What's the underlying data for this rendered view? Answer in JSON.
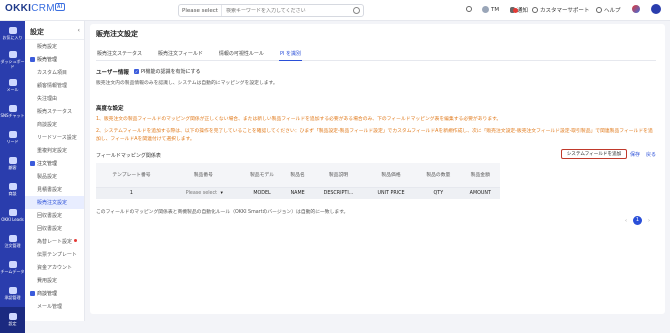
{
  "app": {
    "logo_main": "OKKI",
    "logo_crm": "CRM",
    "logo_ai": "AI"
  },
  "search": {
    "scope": "Please select",
    "placeholder": "検索キーワードを入力してください"
  },
  "topbar": {
    "user": "TM",
    "notice": "通知",
    "support": "カスタマーサポート",
    "help": "ヘルプ"
  },
  "lnav": [
    {
      "label": "お気に入り"
    },
    {
      "label": "ダッシュボード"
    },
    {
      "label": "メール"
    },
    {
      "label": "SNSチャット"
    },
    {
      "label": "リード"
    },
    {
      "label": "顧客"
    },
    {
      "label": "商談"
    },
    {
      "label": "OKKI Leads"
    },
    {
      "label": "注文管理"
    },
    {
      "label": "チームデータ"
    },
    {
      "label": "承認管理"
    },
    {
      "label": "設定"
    }
  ],
  "sidebar": {
    "header": "設定",
    "items": [
      {
        "label": "販売設定",
        "type": "li"
      },
      {
        "label": "販売管理",
        "type": "sec"
      },
      {
        "label": "カスタム項目",
        "type": "li"
      },
      {
        "label": "顧客情報管理",
        "type": "li"
      },
      {
        "label": "失注理由",
        "type": "li"
      },
      {
        "label": "販売ステータス",
        "type": "li"
      },
      {
        "label": "商談設定",
        "type": "li"
      },
      {
        "label": "リードソース設定",
        "type": "li"
      },
      {
        "label": "重複判定設定",
        "type": "li"
      },
      {
        "label": "注文管理",
        "type": "sec"
      },
      {
        "label": "製品設定",
        "type": "li"
      },
      {
        "label": "見積書設定",
        "type": "li"
      },
      {
        "label": "販売注文設定",
        "type": "li",
        "selected": true
      },
      {
        "label": "回収書設定",
        "type": "li"
      },
      {
        "label": "回収書設定",
        "type": "li"
      },
      {
        "label": "為替レート設定",
        "type": "li",
        "dot": true
      },
      {
        "label": "伝票テンプレート",
        "type": "li"
      },
      {
        "label": "資金アカウント",
        "type": "li"
      },
      {
        "label": "費用設定",
        "type": "li"
      },
      {
        "label": "商談管理",
        "type": "sec"
      },
      {
        "label": "メール管理",
        "type": "li"
      }
    ]
  },
  "main": {
    "title": "販売注文設定",
    "tabs": [
      "販売注文ステータス",
      "販売注文フィールド",
      "情報の可視性ルール",
      "PI を識別"
    ],
    "active_tab": 3,
    "user_info_title": "ユーザー情報",
    "pi_toggle_label": "PI機能の認識を有効にする",
    "pi_note": "販売注文内の製品情報のみを認識し、システムは自動的にマッピングを設定します。",
    "advanced_title": "高度な設定",
    "warn1": "1、販売注文の製品フィールドのマッピング関係が正しくない場合、または新しい製品フィールドを追加する必要がある場合のみ、下のフィールドマッピング表を編集する必要があります。",
    "warn2": "2、システムフィールドを追加する際は、以下の操作を完了していることを確認してください：ひまず「製品設定-製品フィールド設定」でカスタムフィールドAを新規作成し、次に「販売注文設定-販売注文フィールド設定-取引製品」で関連製品フィールドを追加し、フィールドAを関連付けて選択します。",
    "mapping_title": "フィールドマッピング関係表",
    "add_button": "システムフィールドを追加",
    "save_link": "保存",
    "back_link": "戻る",
    "columns": [
      "テンプレート番号",
      "製品番号",
      "製品モデル",
      "製品名",
      "製品説明",
      "製品価格",
      "製品の数量",
      "製品金額"
    ],
    "row": {
      "no": "1",
      "product_no": "Please select",
      "model": "MODEL",
      "name": "NAME",
      "desc": "DESCRIPTI...",
      "price": "UNIT PRICE",
      "qty": "QTY",
      "amount": "AMOUNT"
    },
    "footnote": "このフィールドのマッピング関係表と商機製品の自動化ルール（OKKI Smartのバージョン）は自動的に一致します。",
    "page": "1"
  }
}
